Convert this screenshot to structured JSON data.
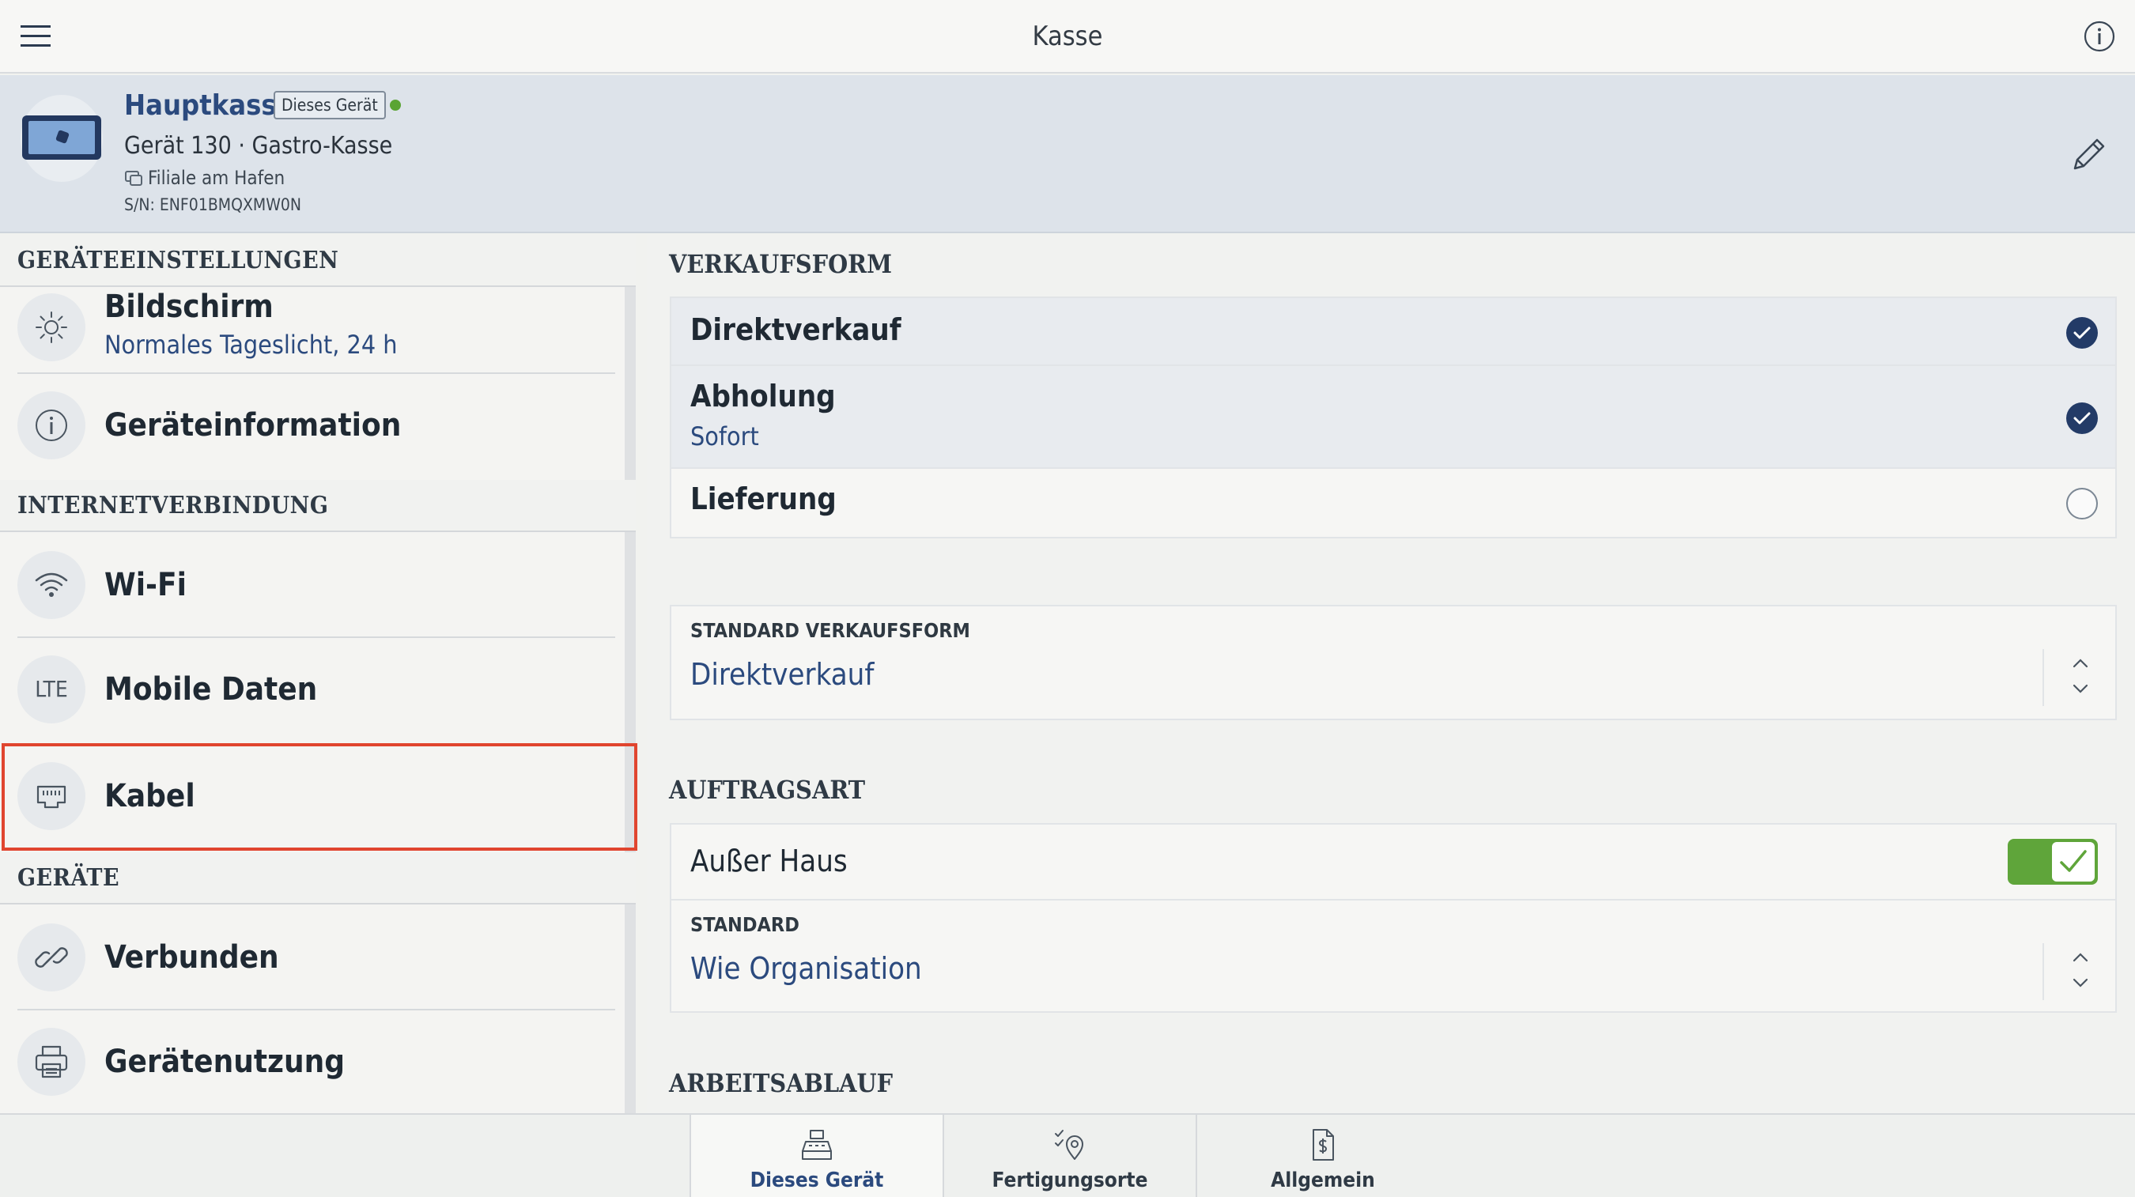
{
  "topbar": {
    "title": "Kasse"
  },
  "device": {
    "name": "Hauptkasse",
    "badge": "Dieses Gerät",
    "type": "Gerät 130 · Gastro-Kasse",
    "location": "Filiale am Hafen",
    "serial": "S/N: ENF01BMQXMW0N",
    "online_color": "#5aa434"
  },
  "sidebar": {
    "sections": [
      {
        "label": "GERÄTEEINSTELLUNGEN",
        "items": [
          {
            "label": "Bildschirm",
            "sub": "Normales Tageslicht, 24 h",
            "icon": "sun-icon"
          },
          {
            "label": "Geräteinformation",
            "icon": "info-circle-icon"
          }
        ]
      },
      {
        "label": "INTERNETVERBINDUNG",
        "items": [
          {
            "label": "Wi-Fi",
            "icon": "wifi-icon"
          },
          {
            "label": "Mobile Daten",
            "icon": "lte-icon",
            "icon_text": "LTE"
          },
          {
            "label": "Kabel",
            "icon": "ethernet-icon",
            "selected": true
          }
        ]
      },
      {
        "label": "GERÄTE",
        "items": [
          {
            "label": "Verbunden",
            "icon": "link-icon"
          },
          {
            "label": "Gerätenutzung",
            "icon": "printer-icon"
          }
        ]
      }
    ]
  },
  "main": {
    "verkaufsform": {
      "title": "VERKAUFSFORM",
      "options": [
        {
          "label": "Direktverkauf",
          "checked": true
        },
        {
          "label": "Abholung",
          "sub": "Sofort",
          "checked": true
        },
        {
          "label": "Lieferung",
          "checked": false
        }
      ],
      "standard": {
        "label": "STANDARD VERKAUFSFORM",
        "value": "Direktverkauf"
      }
    },
    "auftragsart": {
      "title": "AUFTRAGSART",
      "toggle_label": "Außer Haus",
      "toggle_on": true,
      "standard": {
        "label": "STANDARD",
        "value": "Wie Organisation"
      }
    },
    "arbeitsablauf": {
      "title": "ARBEITSABLAUF"
    }
  },
  "tabs": [
    {
      "label": "Dieses Gerät",
      "icon": "cash-register-icon",
      "active": true
    },
    {
      "label": "Fertigungsorte",
      "icon": "location-check-icon",
      "active": false
    },
    {
      "label": "Allgemein",
      "icon": "document-dollar-icon",
      "active": false
    }
  ],
  "colors": {
    "accent": "#2b4a7e",
    "check": "#233b67",
    "toggle_on": "#5fa53a",
    "selection_outline": "#e0452f"
  }
}
